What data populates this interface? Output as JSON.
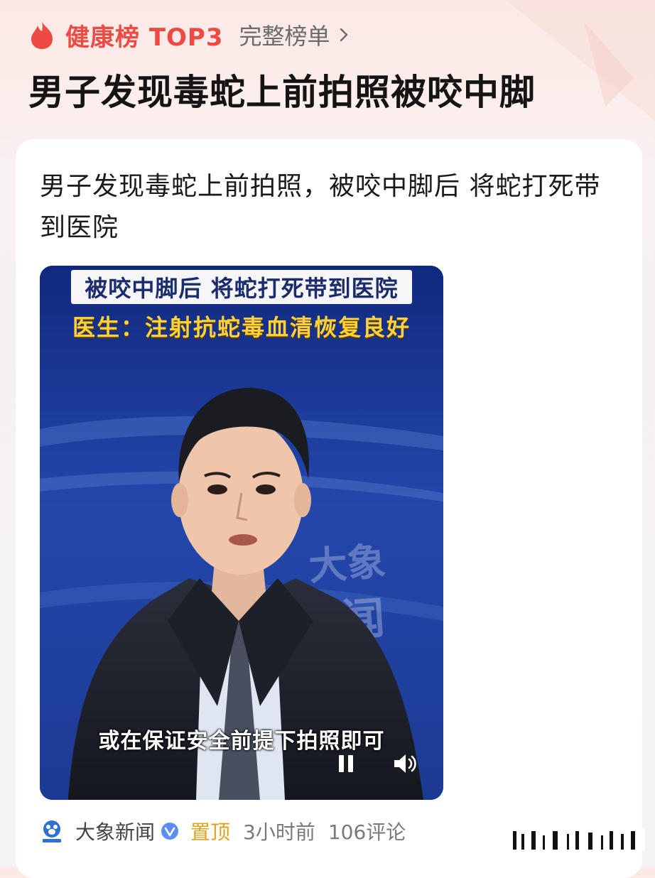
{
  "header": {
    "rank_label": "健康榜 TOP3",
    "full_list_label": "完整榜单",
    "headline": "男子发现毒蛇上前拍照被咬中脚"
  },
  "post": {
    "text": "男子发现毒蛇上前拍照，被咬中脚后 将蛇打死带到医院"
  },
  "video": {
    "caption_line1": "被咬中脚后 将蛇打死带到医院",
    "caption_line2": "医生：注射抗蛇毒血清恢复良好",
    "subtitle": "或在保证安全前提下拍照即可",
    "watermark_text": "大象新闻"
  },
  "meta": {
    "source": "大象新闻",
    "pinned": "置顶",
    "time": "3小时前",
    "comments": "106评论"
  },
  "colors": {
    "rank_red": "#ec4a43",
    "pinned_gold": "#e1a21a",
    "caption_yellow": "#ffd23a"
  }
}
